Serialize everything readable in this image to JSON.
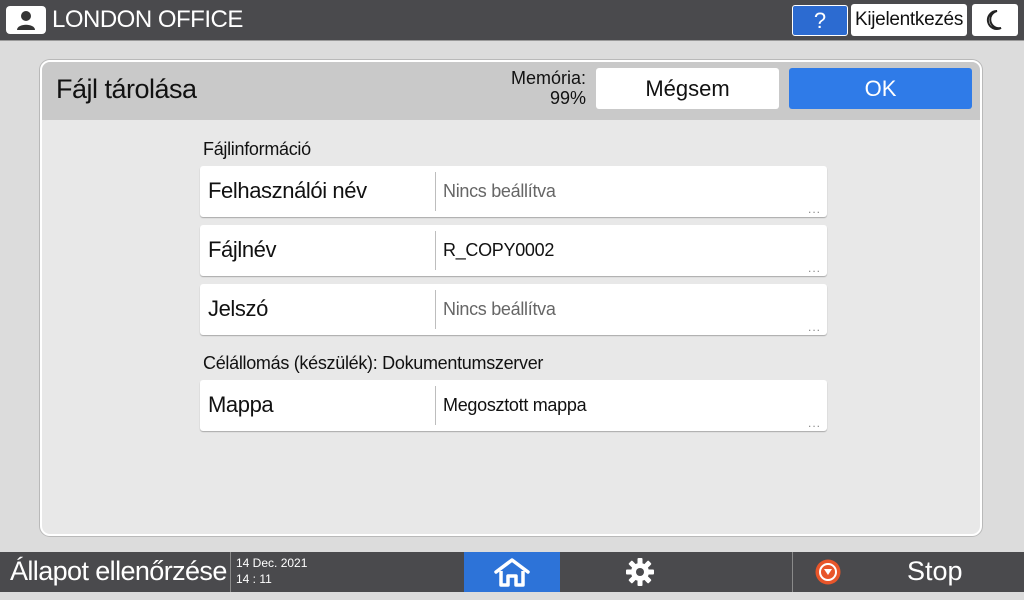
{
  "topbar": {
    "title": "LONDON OFFICE",
    "help_label": "?",
    "logout_label": "Kijelentkezés"
  },
  "dialog": {
    "title": "Fájl tárolása",
    "memory_label": "Memória:",
    "memory_value": "99%",
    "cancel_label": "Mégsem",
    "ok_label": "OK",
    "file_info_label": "Fájlinformáció",
    "fields": [
      {
        "label": "Felhasználói név",
        "value": "Nincs beállítva"
      },
      {
        "label": "Fájlnév",
        "value": "R_COPY0002"
      },
      {
        "label": "Jelszó",
        "value": "Nincs beállítva"
      }
    ],
    "destination_label": "Célállomás (készülék): Dokumentumszerver",
    "folder_field": {
      "label": "Mappa",
      "value": "Megosztott mappa"
    },
    "more_indicator": "..."
  },
  "bottombar": {
    "status_check_label": "Állapot ellenőrzése",
    "date": "14 Dec. 2021",
    "time": "14 : 11",
    "stop_label": "Stop"
  },
  "colors": {
    "bar_bg": "#4a4a4d",
    "accent_blue": "#2f7be8",
    "home_blue": "#2d73d8",
    "stop_orange": "#e8552a"
  },
  "icons": [
    "user-icon",
    "help-icon",
    "moon-icon",
    "home-icon",
    "gear-icon",
    "stop-icon"
  ]
}
